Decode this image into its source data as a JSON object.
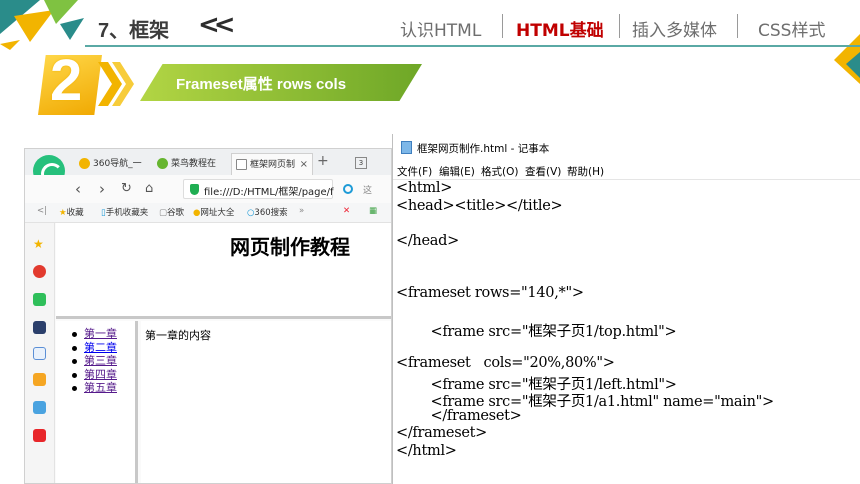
{
  "header": {
    "chapter_title": "7、框架",
    "chevrons": "«",
    "nav": [
      "认识HTML",
      "HTML基础",
      "插入多媒体",
      "CSS样式"
    ],
    "active_nav_index": 1
  },
  "section": {
    "number": "2",
    "title": "Frameset属性 rows   cols"
  },
  "browser": {
    "tabs": [
      {
        "label": "360导航_一"
      },
      {
        "label": "菜鸟教程在"
      },
      {
        "label": "框架网页制"
      }
    ],
    "tab_close": "×",
    "new_tab": "+",
    "tab_count": "3",
    "address": "file:///D:/HTML/框架/page/f",
    "search_hint": "这",
    "bookmarks": [
      "收藏",
      "手机收藏夹",
      "谷歌",
      "网址大全",
      "360搜索",
      "»"
    ],
    "top_frame_title": "网页制作教程",
    "chapters": [
      "第一章",
      "第二章",
      "第三章",
      "第四章",
      "第五章"
    ],
    "main_content": "第一章的内容"
  },
  "notepad": {
    "title": "框架网页制作.html - 记事本",
    "menus": [
      "文件(F)",
      "编辑(E)",
      "格式(O)",
      "查看(V)",
      "帮助(H)"
    ],
    "code": [
      "<html>",
      "<head><title></title>",
      "",
      "</head>",
      "",
      "",
      "<frameset rows=\"140,*\">",
      "",
      "        <frame src=\"框架子页1/top.html\">",
      "",
      "<frameset   cols=\"20%,80%\">",
      "        <frame src=\"框架子页1/left.html\">",
      "        <frame src=\"框架子页1/a1.html\" name=\"main\">",
      "        </frameset>",
      "</frameset>",
      "</html>"
    ]
  },
  "colors": {
    "active_nav": "#c00000",
    "header_line": "#5aa9a5",
    "banner_start": "#b2d544",
    "banner_end": "#6ea727",
    "number_badge": "#f0a800"
  }
}
